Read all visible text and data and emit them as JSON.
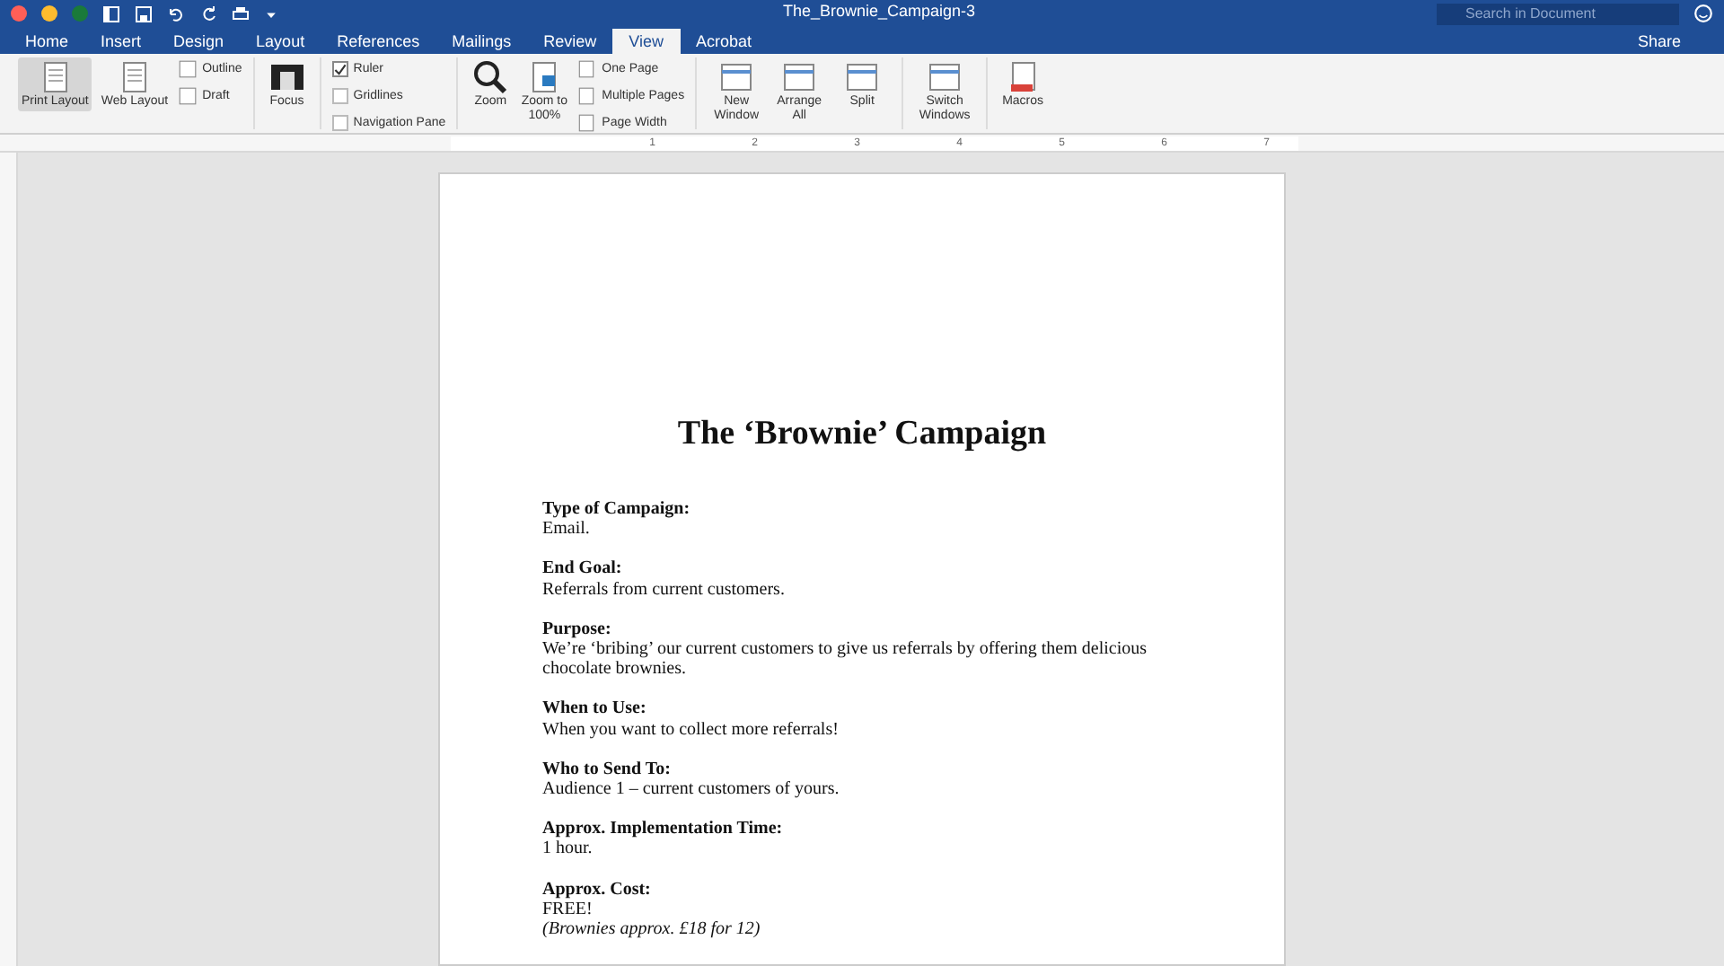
{
  "window": {
    "title": "The_Brownie_Campaign-3",
    "search_placeholder": "Search in Document",
    "share": "Share"
  },
  "tabs": [
    {
      "label": "Home",
      "selected": false
    },
    {
      "label": "Insert",
      "selected": false
    },
    {
      "label": "Design",
      "selected": false
    },
    {
      "label": "Layout",
      "selected": false
    },
    {
      "label": "References",
      "selected": false
    },
    {
      "label": "Mailings",
      "selected": false
    },
    {
      "label": "Review",
      "selected": false
    },
    {
      "label": "View",
      "selected": true
    },
    {
      "label": "Acrobat",
      "selected": false
    }
  ],
  "ribbon": {
    "views": [
      {
        "label": "Print Layout",
        "selected": true
      },
      {
        "label": "Web Layout",
        "selected": false
      }
    ],
    "small_views": [
      "Outline",
      "Draft"
    ],
    "focus": "Focus",
    "show": [
      {
        "label": "Ruler",
        "checked": true
      },
      {
        "label": "Gridlines",
        "checked": false
      },
      {
        "label": "Navigation Pane",
        "checked": false
      }
    ],
    "zoom": [
      "Zoom",
      "Zoom to 100%"
    ],
    "page_views": [
      "One Page",
      "Multiple Pages",
      "Page Width"
    ],
    "window_buttons": [
      "New Window",
      "Arrange All",
      "Split"
    ],
    "switch": "Switch Windows",
    "macros": "Macros"
  },
  "ruler": [
    "1",
    "2",
    "3",
    "4",
    "5",
    "6",
    "7"
  ],
  "document": {
    "title": "The ‘Brownie’ Campaign",
    "sections": [
      {
        "label": "Type of Campaign:",
        "lines": [
          {
            "kind": "plain",
            "text": "Email."
          }
        ]
      },
      {
        "label": "End Goal:",
        "lines": [
          {
            "kind": "plain",
            "text": "Referrals from current customers."
          }
        ]
      },
      {
        "label": "Purpose:",
        "lines": [
          {
            "kind": "plain",
            "text": "We’re ‘bribing’ our current customers to give us referrals by offering them delicious chocolate brownies."
          }
        ]
      },
      {
        "label": "When to Use:",
        "lines": [
          {
            "kind": "plain",
            "text": "When you want to collect more referrals!"
          }
        ]
      },
      {
        "label": "Who to Send To:",
        "lines": [
          {
            "kind": "plain",
            "text": "Audience 1 – current customers of yours."
          }
        ]
      },
      {
        "label": "Approx. Implementation Time:",
        "lines": [
          {
            "kind": "plain",
            "text": "1 hour."
          }
        ]
      },
      {
        "label": "Approx. Cost:",
        "lines": [
          {
            "kind": "plain",
            "text": "FREE!"
          },
          {
            "kind": "italic",
            "text": "(Brownies approx. £18 for 12)"
          }
        ]
      }
    ]
  }
}
